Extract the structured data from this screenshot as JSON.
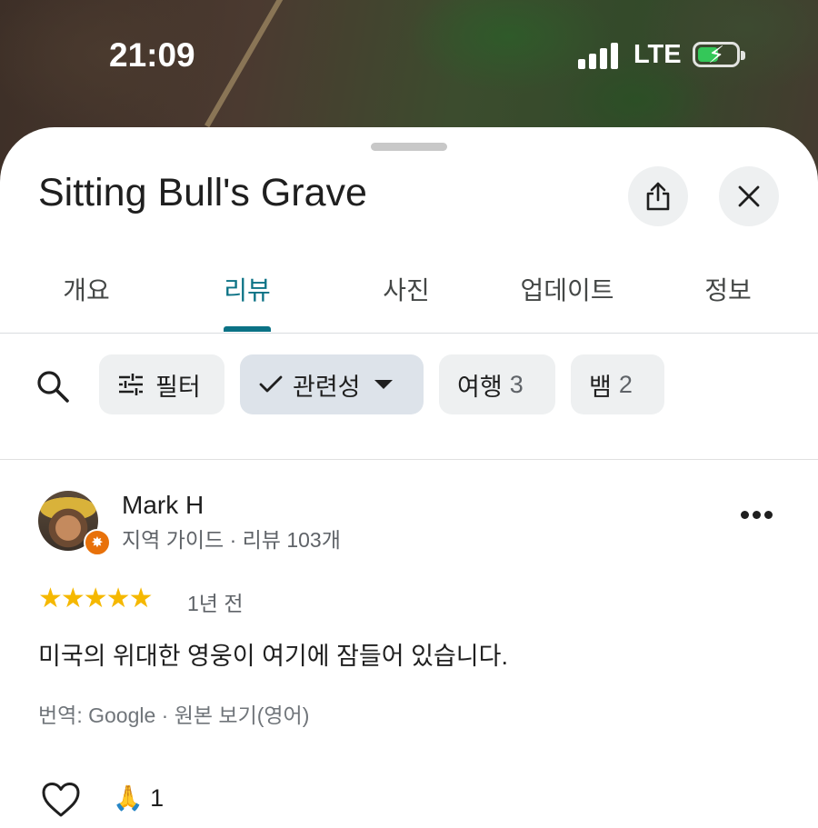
{
  "status_bar": {
    "time": "21:09",
    "network": "LTE",
    "battery_charging": true,
    "battery_fill": 0.55
  },
  "place": {
    "title": "Sitting Bull's Grave",
    "share_icon": "share-icon",
    "close_icon": "close-icon"
  },
  "tabs": [
    {
      "label": "개요",
      "active": false
    },
    {
      "label": "리뷰",
      "active": true
    },
    {
      "label": "사진",
      "active": false
    },
    {
      "label": "업데이트",
      "active": false
    },
    {
      "label": "정보",
      "active": false
    }
  ],
  "filters": {
    "search_icon": "search-icon",
    "filter_label": "필터",
    "sort_label": "관련성",
    "topics": [
      {
        "label": "여행",
        "count": "3"
      },
      {
        "label": "뱀",
        "count": "2"
      }
    ]
  },
  "review": {
    "name": "Mark H",
    "meta": "지역 가이드 · 리뷰 103개",
    "rating": 5,
    "time_ago": "1년 전",
    "text": "미국의 위대한 영웅이 여기에 잠들어 있습니다.",
    "translation": "번역: Google · 원본 보기(영어)",
    "reaction_emoji": "🙏",
    "reaction_count": "1"
  },
  "colors": {
    "accent": "#0b7285",
    "star": "#f5b800",
    "chip_bg": "#eef0f1",
    "chip_selected_bg": "#dde3ea",
    "badge": "#e8710a",
    "battery": "#34c759"
  }
}
